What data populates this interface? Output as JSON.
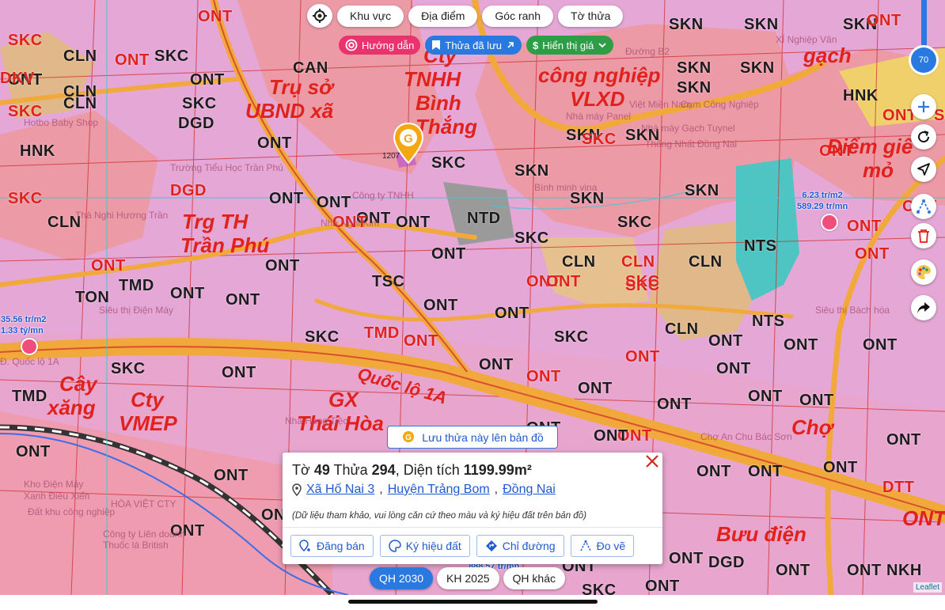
{
  "map": {
    "zone_labels": [
      {
        "text": "SKC",
        "color": "red"
      },
      {
        "text": "CLN",
        "color": "dark"
      },
      {
        "text": "SKC",
        "color": "dark"
      },
      {
        "text": "ONT",
        "color": "red"
      },
      {
        "text": "ONT",
        "color": "dark"
      },
      {
        "text": "ONT",
        "color": "dark"
      },
      {
        "text": "SKN",
        "color": "dark"
      },
      {
        "text": "SKN",
        "color": "dark"
      },
      {
        "text": "SKN",
        "color": "dark"
      },
      {
        "text": "ONT",
        "color": "red"
      },
      {
        "text": "DKV",
        "color": "red"
      },
      {
        "text": "CLN",
        "color": "dark"
      },
      {
        "text": "CAN",
        "color": "dark"
      },
      {
        "text": "SKN",
        "color": "dark"
      },
      {
        "text": "SKN",
        "color": "dark"
      },
      {
        "text": "SKN",
        "color": "dark"
      },
      {
        "text": "HNK",
        "color": "dark"
      },
      {
        "text": "SKC",
        "color": "red"
      },
      {
        "text": "SKC",
        "color": "dark"
      },
      {
        "text": "CLN",
        "color": "dark"
      },
      {
        "text": "DGD",
        "color": "dark"
      },
      {
        "text": "ONT",
        "color": "dark"
      },
      {
        "text": "SKN",
        "color": "dark"
      },
      {
        "text": "SKN",
        "color": "dark"
      },
      {
        "text": "ONT",
        "color": "dark"
      },
      {
        "text": "ONT",
        "color": "dark"
      },
      {
        "text": "SKC",
        "color": "dark"
      },
      {
        "text": "SKN",
        "color": "dark"
      },
      {
        "text": "HNK",
        "color": "dark"
      },
      {
        "text": "SKC",
        "color": "red"
      },
      {
        "text": "DGD",
        "color": "red"
      },
      {
        "text": "ONT",
        "color": "dark"
      },
      {
        "text": "ONT",
        "color": "dark"
      },
      {
        "text": "NTD",
        "color": "dark"
      },
      {
        "text": "SKN",
        "color": "dark"
      },
      {
        "text": "SKN",
        "color": "dark"
      },
      {
        "text": "SKC",
        "color": "dark"
      },
      {
        "text": "ONT",
        "color": "red"
      },
      {
        "text": "CLN",
        "color": "dark"
      },
      {
        "text": "ONT",
        "color": "red"
      },
      {
        "text": "ONT",
        "color": "dark"
      },
      {
        "text": "SKC",
        "color": "dark"
      },
      {
        "text": "CLN",
        "color": "dark"
      },
      {
        "text": "NTS",
        "color": "dark"
      },
      {
        "text": "ONT",
        "color": "red"
      },
      {
        "text": "ONT",
        "color": "dark"
      },
      {
        "text": "ONT",
        "color": "red"
      },
      {
        "text": "CLN",
        "color": "dark"
      },
      {
        "text": "CLN",
        "color": "red"
      },
      {
        "text": "SKC",
        "color": "red"
      },
      {
        "text": "ONT",
        "color": "red"
      },
      {
        "text": "TMD",
        "color": "dark"
      },
      {
        "text": "ONT",
        "color": "dark"
      },
      {
        "text": "TSC",
        "color": "dark"
      },
      {
        "text": "ONT",
        "color": "dark"
      },
      {
        "text": "ONT",
        "color": "red"
      },
      {
        "text": "TON",
        "color": "dark"
      },
      {
        "text": "ONT",
        "color": "dark"
      },
      {
        "text": "ONT",
        "color": "dark"
      },
      {
        "text": "CLN",
        "color": "dark"
      },
      {
        "text": "NTS",
        "color": "dark"
      },
      {
        "text": "ONT",
        "color": "dark"
      },
      {
        "text": "SKC",
        "color": "dark"
      },
      {
        "text": "TMD",
        "color": "red"
      },
      {
        "text": "ONT",
        "color": "red"
      },
      {
        "text": "SKC",
        "color": "dark"
      },
      {
        "text": "ONT",
        "color": "red"
      },
      {
        "text": "ONT",
        "color": "dark"
      },
      {
        "text": "ONT",
        "color": "dark"
      },
      {
        "text": "SKC",
        "color": "dark"
      },
      {
        "text": "ONT",
        "color": "dark"
      },
      {
        "text": "ONT",
        "color": "red"
      },
      {
        "text": "ONT",
        "color": "dark"
      },
      {
        "text": "ONT",
        "color": "dark"
      },
      {
        "text": "TMD",
        "color": "dark"
      },
      {
        "text": "ONT",
        "color": "dark"
      },
      {
        "text": "ONT",
        "color": "red"
      },
      {
        "text": "ONT",
        "color": "dark"
      },
      {
        "text": "ONT",
        "color": "dark"
      },
      {
        "text": "ONT",
        "color": "dark"
      },
      {
        "text": "ONT",
        "color": "dark"
      },
      {
        "text": "ONT",
        "color": "dark"
      },
      {
        "text": "ONT",
        "color": "dark"
      },
      {
        "text": "ONT",
        "color": "dark"
      },
      {
        "text": "ONT",
        "color": "dark"
      },
      {
        "text": "ONT",
        "color": "dark"
      },
      {
        "text": "ONT",
        "color": "dark"
      },
      {
        "text": "ONT",
        "color": "dark"
      },
      {
        "text": "DTT",
        "color": "red"
      },
      {
        "text": "ONT",
        "color": "dark"
      },
      {
        "text": "ONT",
        "color": "dark"
      },
      {
        "text": "ONT",
        "color": "dark"
      },
      {
        "text": "ONT",
        "color": "dark"
      },
      {
        "text": "ONT",
        "color": "dark"
      },
      {
        "text": "DGD",
        "color": "dark"
      },
      {
        "text": "SKC",
        "color": "dark"
      },
      {
        "text": "ONT",
        "color": "dark"
      },
      {
        "text": "ONT",
        "color": "dark"
      },
      {
        "text": "ONT",
        "color": "dark"
      },
      {
        "text": "NKH",
        "color": "dark"
      },
      {
        "text": "ONT",
        "color": "red"
      },
      {
        "text": "SKC",
        "color": "red"
      },
      {
        "text": "ONT",
        "color": "red"
      },
      {
        "text": "ONT",
        "color": "red"
      },
      {
        "text": "SKC",
        "color": "red"
      },
      {
        "text": "ONT",
        "color": "red"
      },
      {
        "text": "SKC",
        "color": "red"
      }
    ],
    "big_labels": [
      "Trụ sở",
      "UBND xã",
      "Cty",
      "TNHH",
      "Bình",
      "Thắng",
      "công nghiệp",
      "VLXD",
      "Trg TH",
      "Trần Phú",
      "Cây",
      "xăng",
      "Cty",
      "VMEP",
      "GX",
      "Thái Hòa",
      "Quốc lộ 1A",
      "Chợ",
      "Bưu điện",
      "Điểm giê",
      "mỏ",
      "gạch",
      "ONT"
    ],
    "pois": [
      "Trường Tiểu Học Trần Phú",
      "Thà Nghi Hương Trần",
      "Nhà Nghỉ Kim",
      "Công ty TNHH",
      "Hotbo Baby Shop",
      "Nhà máy Gạch Tuynel",
      "Thống Nhất Đồng Nai",
      "Nhà máy Panel",
      "Việt Miền Nam",
      "Bình minh vina",
      "Cụm Công Nghiệp",
      "Siêu thị Điện Máy",
      "Đ. Quốc lộ 1A",
      "Kho Điện Máy",
      "Xanh Điều Xiển",
      "HÒA VIỆT CTY",
      "Công ty Liên doanh",
      "Thuốc lá British",
      "Nhà Hàng Tiệc",
      "Chợ An Chu Bác Sơn",
      "Siêu thị Bách hóa",
      "XÍ Nghiệp Vân",
      "Đường B2",
      "Đất khu công nghiệp"
    ],
    "prices": [
      {
        "line1": "35.56 tr/m2",
        "line2": "1.33 tỷ/mn"
      },
      {
        "line1": "6.23 tr/m2",
        "line2": "589.29 tr/mn"
      },
      {
        "line1": "888.57 tr/mn",
        "line2": ""
      }
    ],
    "marker": {
      "label": "1207"
    },
    "colors": {
      "ont": "#e4a7d6",
      "skn": "#ed9aa7",
      "cln": "#e0b88a",
      "road": "#f2a93c",
      "border_red": "#e0211c",
      "water": "#4ec5c2",
      "brand": "#2a79e0"
    }
  },
  "filters": {
    "locate_icon": "locate-icon",
    "tabs": [
      "Khu vực",
      "Địa điểm",
      "Góc ranh",
      "Tờ thửa"
    ]
  },
  "sub_filters": {
    "guide": "Hướng dẫn",
    "saved": "Thửa đã lưu",
    "price": "Hiển thị giá"
  },
  "right_controls": {
    "zoom_value": "70"
  },
  "save_parcel": "Lưu thửa này lên bản đồ",
  "popup": {
    "title_prefix": "Tờ",
    "sheet": "49",
    "plot_word": "Thửa",
    "plot": "294",
    "area_word": ", Diện tích",
    "area": "1199.99m²",
    "commune": "Xã Hố Nai 3",
    "district": "Huyện Trảng Bom",
    "province": "Đồng Nai",
    "note": "(Dữ liệu tham khảo, vui lòng căn cứ theo màu và ký hiệu đất trên bản đồ)",
    "actions": {
      "post": "Đăng bán",
      "symbols": "Ký hiệu đất",
      "directions": "Chỉ đường",
      "measure": "Đo vẽ"
    }
  },
  "plan_tabs": [
    "QH 2030",
    "KH 2025",
    "QH khác"
  ],
  "attribution": "Leaflet"
}
